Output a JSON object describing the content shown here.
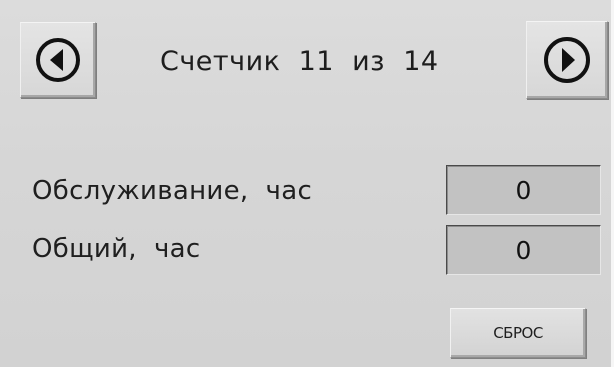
{
  "header": {
    "title": "Счетчик  11  из  14",
    "prev_icon": "arrow-left-circle-icon",
    "next_icon": "arrow-right-circle-icon"
  },
  "counters": {
    "service": {
      "label": "Обслуживание,  час",
      "value": "0"
    },
    "total": {
      "label": "Общий,  час",
      "value": "0"
    }
  },
  "actions": {
    "reset_label": "СБРОС"
  }
}
